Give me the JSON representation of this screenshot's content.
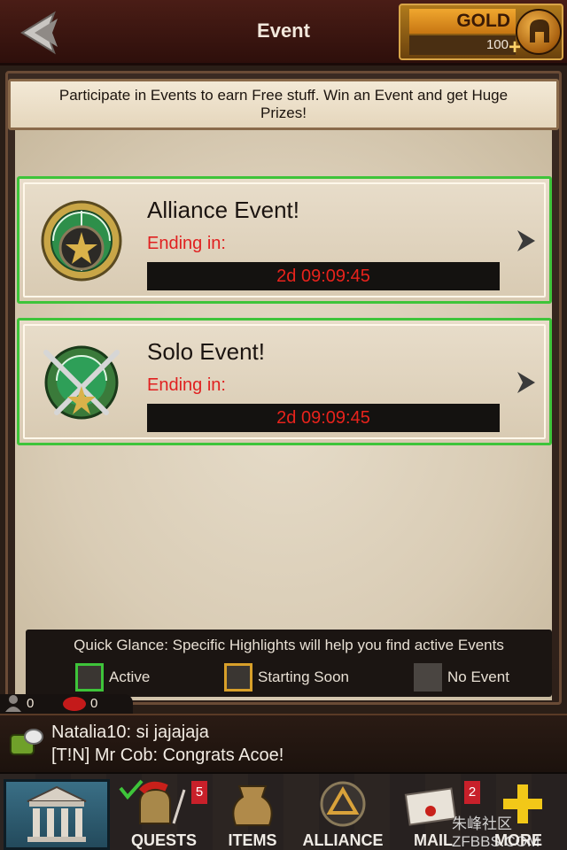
{
  "header": {
    "title": "Event",
    "gold_label": "GOLD",
    "gold_amount": "100"
  },
  "banner": {
    "text": "Participate in Events to earn Free stuff. Win an Event and get Huge Prizes!"
  },
  "events": [
    {
      "title": "Alliance Event!",
      "ending_label": "Ending in:",
      "timer": "2d 09:09:45",
      "icon": "alliance-event-icon"
    },
    {
      "title": "Solo Event!",
      "ending_label": "Ending in:",
      "timer": "2d 09:09:45",
      "icon": "solo-event-icon"
    }
  ],
  "quick_glance": {
    "text": "Quick Glance: Specific Highlights will help you find active Events",
    "legend": [
      {
        "label": "Active",
        "color": "#3ec43a"
      },
      {
        "label": "Starting Soon",
        "color": "#d8a02a"
      },
      {
        "label": "No Event",
        "color": "#4a4541"
      }
    ]
  },
  "counters": {
    "players": "0",
    "messages": "0"
  },
  "chat": {
    "line1": "Natalia10: si jajajaja",
    "line2": "[T!N] Mr Cob: Congrats Acoe!"
  },
  "nav": {
    "items": [
      {
        "label": "QUESTS",
        "badge": "5"
      },
      {
        "label": "ITEMS",
        "badge": ""
      },
      {
        "label": "ALLIANCE",
        "badge": ""
      },
      {
        "label": "MAIL",
        "badge": "2"
      },
      {
        "label": "MORE",
        "badge": ""
      }
    ]
  },
  "watermark": "朱峰社区 ZFBBS.COM",
  "colors": {
    "active": "#3ec43a",
    "timer_text": "#e8231c",
    "ending_text": "#e02020"
  }
}
